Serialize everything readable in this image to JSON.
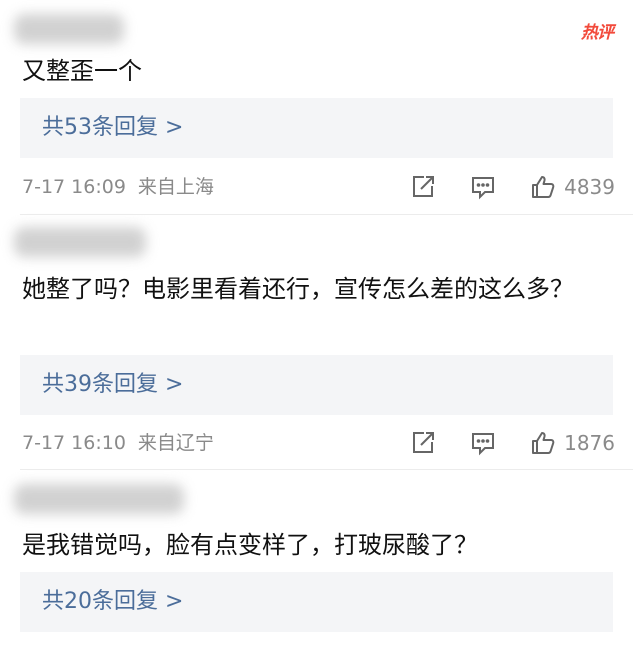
{
  "hot_badge": "热评",
  "comments": [
    {
      "text": "又整歪一个",
      "reply_prefix": "共",
      "reply_count": "53",
      "reply_suffix": "条回复 >",
      "date": "7-17 16:09",
      "location": "来自上海",
      "likes": "4839"
    },
    {
      "text": "她整了吗？电影里看着还行，宣传怎么差的这么多？",
      "reply_prefix": "共",
      "reply_count": "39",
      "reply_suffix": "条回复 >",
      "date": "7-17 16:10",
      "location": "来自辽宁",
      "likes": "1876"
    },
    {
      "text": "是我错觉吗，脸有点变样了，打玻尿酸了？",
      "reply_prefix": "共",
      "reply_count": "20",
      "reply_suffix": "条回复 >"
    }
  ],
  "icons": {
    "share": "share-icon",
    "comment": "comment-icon",
    "like": "like-icon"
  },
  "colors": {
    "link": "#4b6d9a",
    "meta": "#8a8a8a",
    "reply_bg": "#f4f5f7",
    "hot": "#f24a3b"
  }
}
